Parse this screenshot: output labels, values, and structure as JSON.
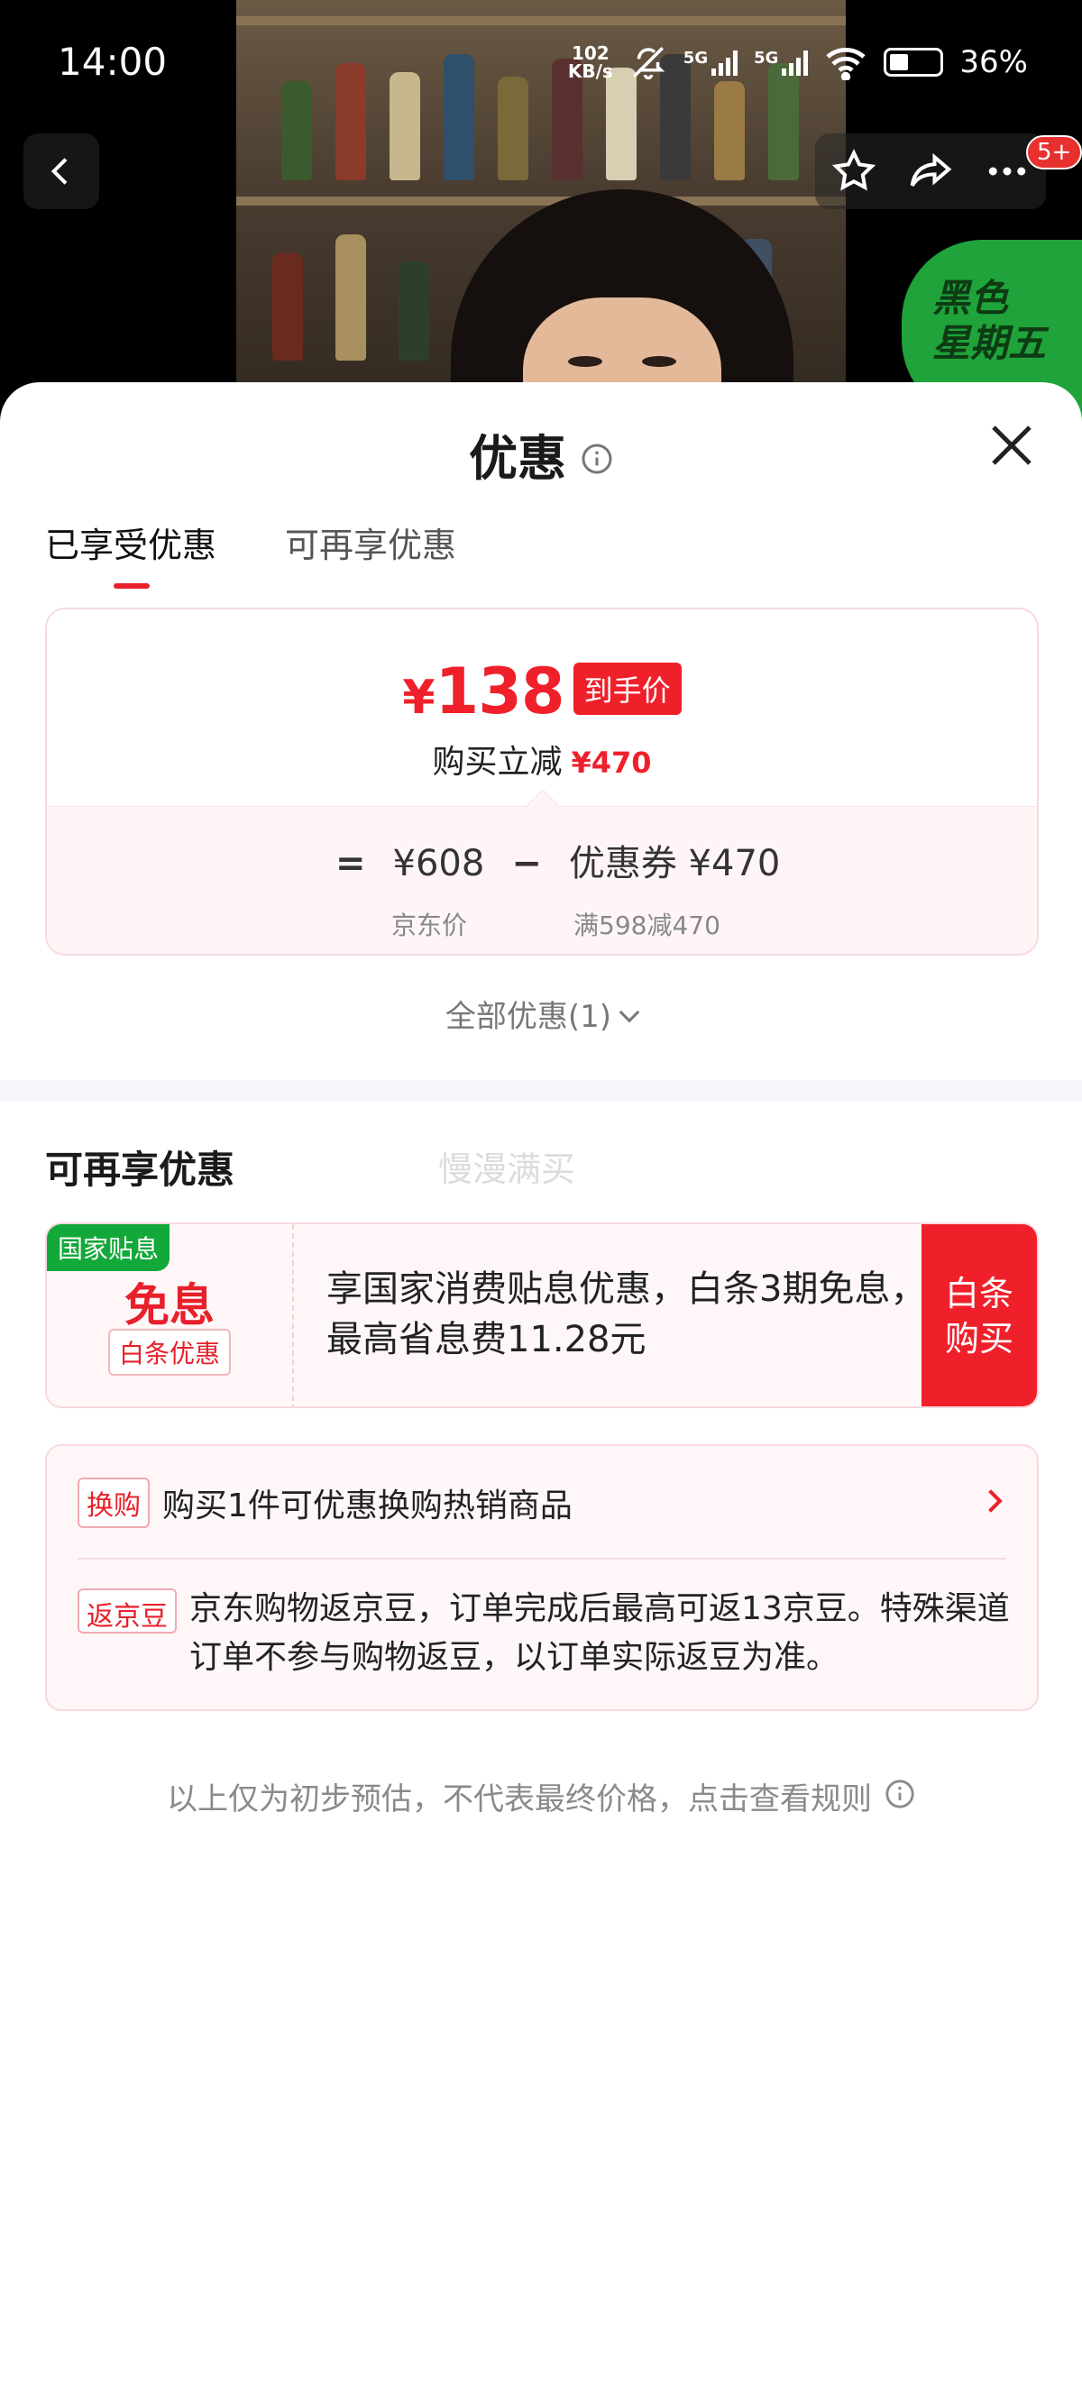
{
  "status_bar": {
    "time": "14:00",
    "net_speed_value": "102",
    "net_speed_unit": "KB/s",
    "network_1": "5G",
    "network_2": "5G",
    "battery": "36%"
  },
  "top_nav": {
    "notification_count": "5+",
    "promo_badge": "黑色星期五",
    "promo_line1": "黑色",
    "promo_line2": "星期五"
  },
  "sheet": {
    "title": "优惠",
    "tabs": [
      {
        "label": "已享受优惠",
        "active": true
      },
      {
        "label": "可再享优惠",
        "active": false
      }
    ]
  },
  "price_card": {
    "currency": "¥",
    "final_price": "138",
    "final_tag": "到手价",
    "reduce_label": "购买立减",
    "reduce_amount": "¥470",
    "equals": "=",
    "jd_price": "¥608",
    "jd_price_label": "京东价",
    "minus": "−",
    "coupon": "优惠券 ¥470",
    "coupon_rule": "满598减470"
  },
  "all_offers": "全部优惠(1)",
  "more_offers": {
    "title": "可再享优惠",
    "ghost_text": "慢漫满买",
    "loan": {
      "tag": "国家贴息",
      "main": "免息",
      "sub": "白条优惠",
      "description": "享国家消费贴息优惠，白条3期免息，最高省息费11.28元",
      "button_line1": "白条",
      "button_line2": "购买"
    },
    "exchange": {
      "tag": "换购",
      "text": "购买1件可优惠换购热销商品"
    },
    "beans": {
      "tag": "返京豆",
      "text": "京东购物返京豆，订单完成后最高可返13京豆。特殊渠道订单不参与购物返豆，以订单实际返豆为准。"
    }
  },
  "footer_note": "以上仅为初步预估，不代表最终价格，点击查看规则",
  "colors": {
    "accent_red": "#f0202b",
    "gov_green": "#13a83a",
    "card_border": "#f7d9dc"
  }
}
